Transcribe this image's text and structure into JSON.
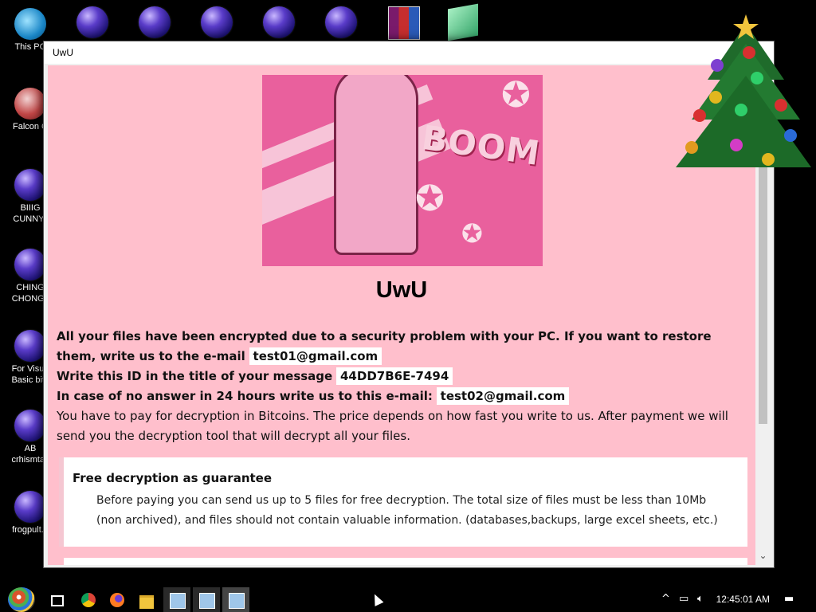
{
  "desktop": {
    "icons": [
      {
        "label": "This PC"
      },
      {
        "label": "Falcon C"
      },
      {
        "label": "BIIIG CUNNY.l"
      },
      {
        "label": "CHING CHONG.l"
      },
      {
        "label": "For Visua Basic bitc"
      },
      {
        "label": "AB crhismtas"
      },
      {
        "label": "frogpult.e"
      }
    ]
  },
  "window": {
    "title": "UwU",
    "heading": "UwU",
    "image": {
      "text": "BOOM"
    },
    "line1_bold": "All your files have been encrypted due to a security problem with your PC. If you want to restore them, write us to the e-mail",
    "email1": "test01@gmail.com",
    "line2_bold": "Write this ID in the title of your message",
    "id": "44DD7B6E-7494",
    "line3_bold": "In case of no answer in 24 hours write us to this e-mail:",
    "email2": "test02@gmail.com",
    "line4": "You have to pay for decryption in Bitcoins. The price depends on how fast you write to us. After payment we will send you the decryption tool that will decrypt all your files.",
    "guarantee_title": "Free decryption as guarantee",
    "guarantee_text": "Before paying you can send us up to 5 files for free decryption. The total size of files must be less than 10Mb (non archived), and files should not contain valuable information. (databases,backups, large excel sheets, etc.)"
  },
  "taskbar": {
    "clock": "12:45:01 AM",
    "tray_chevron": "^"
  },
  "colors": {
    "content_bg": "#ffbfcc",
    "image_bg": "#e9609d"
  }
}
